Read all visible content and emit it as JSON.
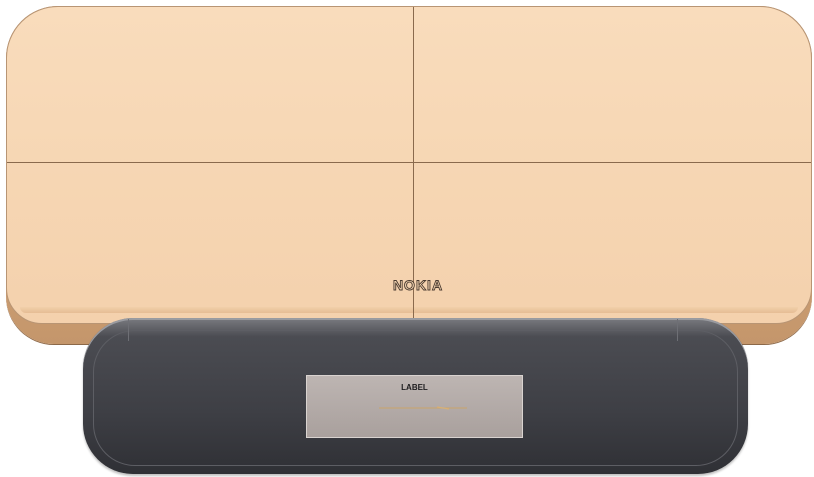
{
  "device": {
    "brand_text": "NOKIA",
    "label_text": "LABEL"
  },
  "colors": {
    "housing": "#f6d6b3",
    "housing_edge": "#c4966b",
    "dock": "#3e3f45",
    "label_plate": "#b1a9a6",
    "label_mark": "#c9a46a"
  }
}
